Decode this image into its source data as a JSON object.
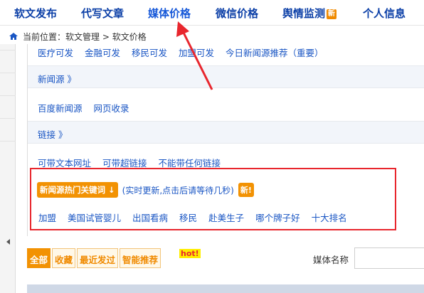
{
  "nav": {
    "items": [
      {
        "label": "软文发布"
      },
      {
        "label": "代写文章"
      },
      {
        "label": "媒体价格"
      },
      {
        "label": "微信价格"
      },
      {
        "label": "舆情监测",
        "badge": "新"
      },
      {
        "label": "个人信息"
      }
    ],
    "active_index": 2
  },
  "breadcrumb": {
    "prefix": "当前位置：",
    "path": "软文管理 > 软文价格"
  },
  "content": {
    "row1": [
      "医疗可发",
      "金融可发",
      "移民可发",
      "加盟可发",
      "今日新闻源推荐（重要）"
    ],
    "section_news": "新闻源 》",
    "row2": [
      "百度新闻源",
      "网页收录"
    ],
    "section_link": "链接 》",
    "row3": [
      "可带文本网址",
      "可带超链接",
      "不能带任何链接"
    ]
  },
  "hot_keywords": {
    "button": "新闻源热门关键词 ↓",
    "note": "(实时更新,点击后请等待几秒)",
    "new_tag": "新!",
    "keywords": [
      "加盟",
      "美国试管婴儿",
      "出国看病",
      "移民",
      "赴美生子",
      "哪个牌子好",
      "十大排名"
    ]
  },
  "filters": {
    "tabs": [
      "全部",
      "收藏",
      "最近发过",
      "智能推荐"
    ],
    "hot": "hot!",
    "media_name_label": "媒体名称",
    "media_name_value": ""
  },
  "colors": {
    "brand_blue": "#0b3fa7",
    "link_blue": "#1a56c4",
    "accent_orange": "#f29203",
    "highlight_red": "#e8262d"
  }
}
